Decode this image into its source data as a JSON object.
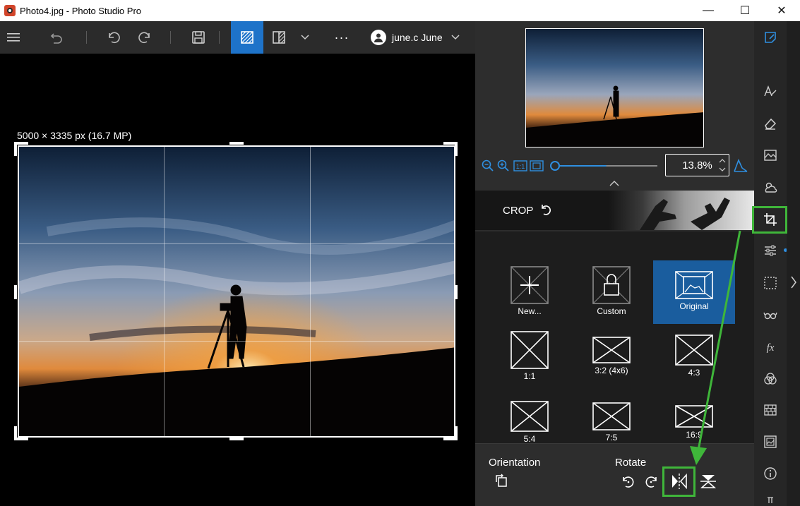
{
  "window": {
    "title": "Photo4.jpg - Photo Studio Pro",
    "controls": {
      "minimize": "—",
      "maximize": "☐",
      "close": "✕"
    }
  },
  "toolbar": {
    "user_name": "june.c June",
    "more": "···"
  },
  "canvas": {
    "dimensions_label": "5000 × 3335 px (16.7 MP)"
  },
  "zoom": {
    "value": "13.8%",
    "slider_level": 0.12
  },
  "crop": {
    "title": "CROP",
    "presets": [
      {
        "label": "New...",
        "icon": "plus-icon"
      },
      {
        "label": "Custom",
        "icon": "lock-icon"
      },
      {
        "label": "Original",
        "icon": "image-icon",
        "selected": true
      },
      {
        "label": "1:1",
        "icon": "ratio-icon"
      },
      {
        "label": "3:2 (4x6)",
        "icon": "ratio-icon"
      },
      {
        "label": "4:3",
        "icon": "ratio-icon"
      },
      {
        "label": "5:4",
        "icon": "ratio-icon"
      },
      {
        "label": "7:5",
        "icon": "ratio-icon"
      },
      {
        "label": "16:9",
        "icon": "ratio-icon"
      }
    ]
  },
  "bottom": {
    "orientation_label": "Orientation",
    "rotate_label": "Rotate"
  },
  "colors": {
    "accent": "#1e73c9",
    "highlight": "#3fb63a",
    "panel": "#2d2d2d"
  }
}
